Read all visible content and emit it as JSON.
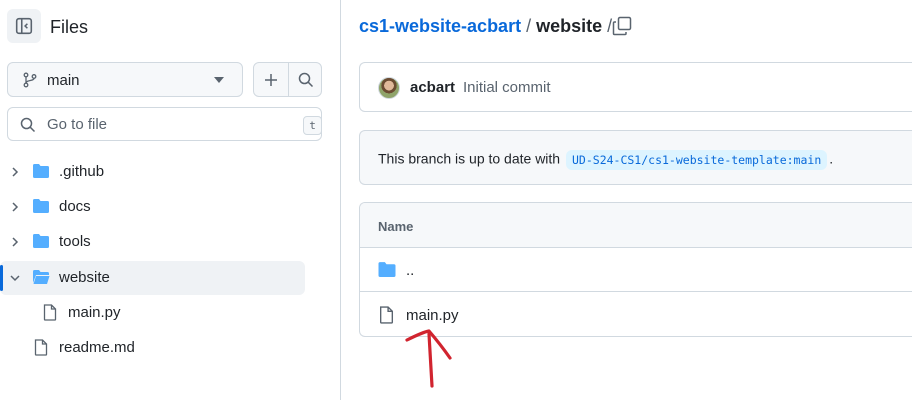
{
  "sidebar": {
    "title": "Files",
    "branch": "main",
    "goto_placeholder": "Go to file",
    "goto_shortcut": "t",
    "tree": [
      {
        "label": ".github",
        "type": "folder"
      },
      {
        "label": "docs",
        "type": "folder"
      },
      {
        "label": "tools",
        "type": "folder"
      },
      {
        "label": "website",
        "type": "folder",
        "expanded": true,
        "selected": true
      },
      {
        "label": "main.py",
        "type": "file",
        "indent": 1
      },
      {
        "label": "readme.md",
        "type": "file"
      }
    ]
  },
  "main": {
    "breadcrumb": {
      "repo": "cs1-website-acbart",
      "sep1": "/",
      "dir": "website",
      "sep2": "/"
    },
    "commit": {
      "author": "acbart",
      "message": "Initial commit"
    },
    "branch_status": {
      "prefix": "This branch is up to date with",
      "ref": "UD-S24-CS1/cs1-website-template:main",
      "suffix": "."
    },
    "table": {
      "header_name": "Name",
      "rows": [
        {
          "label": "..",
          "type": "folder"
        },
        {
          "label": "main.py",
          "type": "file"
        }
      ]
    }
  },
  "colors": {
    "accent": "#0969da",
    "folder": "#54aeff",
    "annotation": "#d1242f"
  },
  "icons": [
    "sidebar-collapse-icon",
    "git-branch-icon",
    "triangle-down-icon",
    "plus-icon",
    "search-icon",
    "chevron-right-icon",
    "chevron-down-icon",
    "folder-icon",
    "file-icon",
    "copy-icon"
  ]
}
